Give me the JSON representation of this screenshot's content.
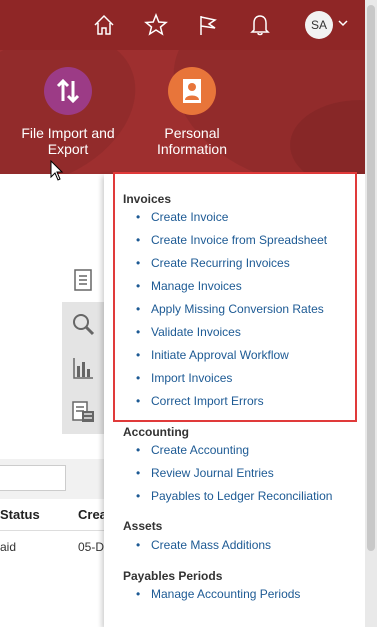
{
  "header": {
    "avatar_initials": "SA",
    "icons": [
      "home-icon",
      "favorites-star-icon",
      "watchlist-flag-icon",
      "notifications-bell-icon",
      "chevron-down-icon"
    ]
  },
  "apps": [
    {
      "label_line1": "File Import and",
      "label_line2": "Export",
      "icon": "import-export-arrows-icon",
      "color": "#9c3b86"
    },
    {
      "label_line1": "Personal",
      "label_line2": "Information",
      "icon": "person-badge-icon",
      "color": "#e8753a"
    }
  ],
  "background": {
    "table_headers": [
      "Status",
      "Crea"
    ],
    "row_values": [
      "aid",
      "05-D"
    ]
  },
  "menu": {
    "sections": [
      {
        "title": "Invoices",
        "items": [
          "Create Invoice",
          "Create Invoice from Spreadsheet",
          "Create Recurring Invoices",
          "Manage Invoices",
          "Apply Missing Conversion Rates",
          "Validate Invoices",
          "Initiate Approval Workflow",
          "Import Invoices",
          "Correct Import Errors"
        ]
      },
      {
        "title": "Accounting",
        "items": [
          "Create Accounting",
          "Review Journal Entries",
          "Payables to Ledger Reconciliation"
        ]
      },
      {
        "title": "Assets",
        "items": [
          "Create Mass Additions"
        ]
      },
      {
        "title": "Payables Periods",
        "items": [
          "Manage Accounting Periods"
        ]
      }
    ]
  },
  "colors": {
    "topbar": "#8f2626",
    "banner": "#9e2f2f",
    "link": "#1d5a94",
    "highlight_box": "#e03a3a"
  }
}
